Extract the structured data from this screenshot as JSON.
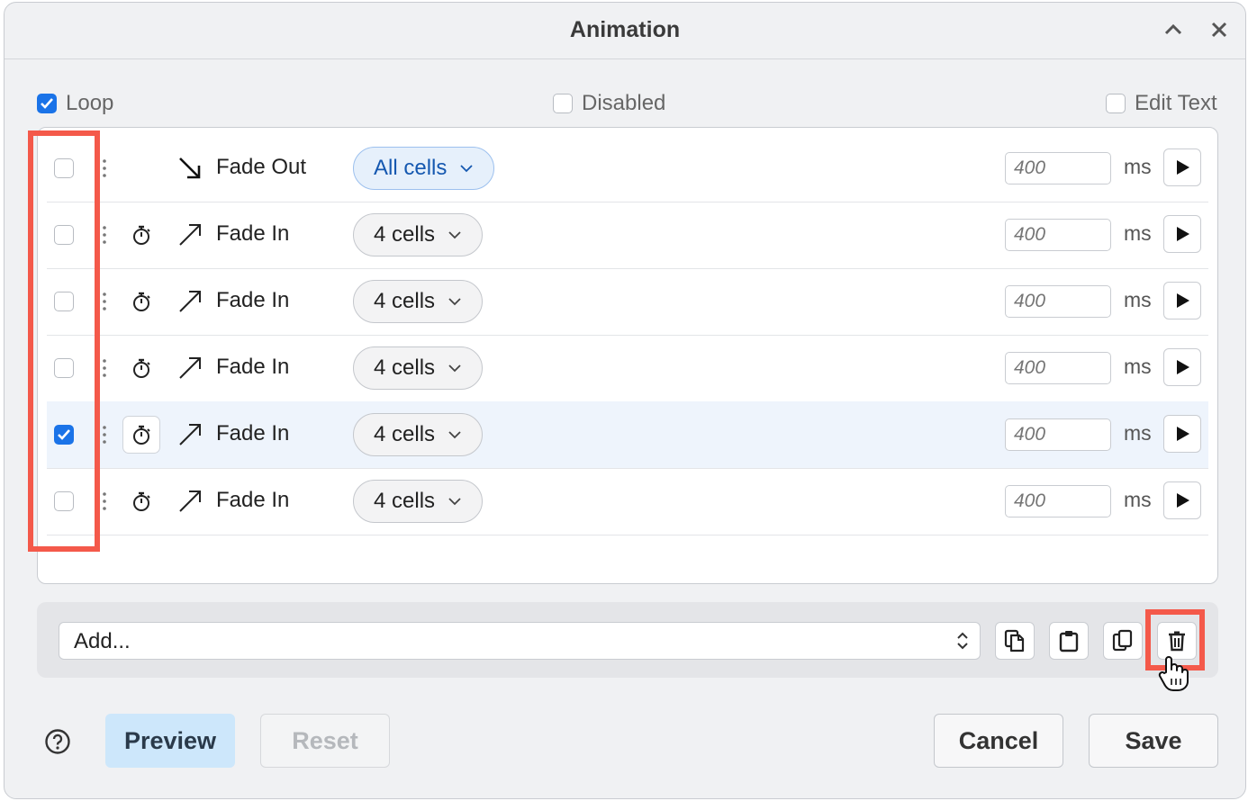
{
  "title": "Animation",
  "options": {
    "loop_label": "Loop",
    "loop_checked": true,
    "disabled_label": "Disabled",
    "edit_text_label": "Edit Text"
  },
  "rows": [
    {
      "effect": "Fade Out",
      "target": "All cells",
      "duration_placeholder": "400",
      "unit": "ms",
      "checked": false,
      "has_timer": false,
      "direction": "down-right"
    },
    {
      "effect": "Fade In",
      "target": "4 cells",
      "duration_placeholder": "400",
      "unit": "ms",
      "checked": false,
      "has_timer": true,
      "direction": "up-right"
    },
    {
      "effect": "Fade In",
      "target": "4 cells",
      "duration_placeholder": "400",
      "unit": "ms",
      "checked": false,
      "has_timer": true,
      "direction": "up-right"
    },
    {
      "effect": "Fade In",
      "target": "4 cells",
      "duration_placeholder": "400",
      "unit": "ms",
      "checked": false,
      "has_timer": true,
      "direction": "up-right"
    },
    {
      "effect": "Fade In",
      "target": "4 cells",
      "duration_placeholder": "400",
      "unit": "ms",
      "checked": true,
      "has_timer": true,
      "direction": "up-right"
    },
    {
      "effect": "Fade In",
      "target": "4 cells",
      "duration_placeholder": "400",
      "unit": "ms",
      "checked": false,
      "has_timer": true,
      "direction": "up-right"
    }
  ],
  "add_select": {
    "value": "Add..."
  },
  "toolbar_icons": [
    "copy-icon",
    "paste-icon",
    "duplicate-icon",
    "trash-icon"
  ],
  "footer": {
    "preview_label": "Preview",
    "reset_label": "Reset",
    "cancel_label": "Cancel",
    "save_label": "Save"
  },
  "colors": {
    "accent": "#1a73e8",
    "highlight": "#f4594a",
    "preview_bg": "#cde7fb"
  }
}
